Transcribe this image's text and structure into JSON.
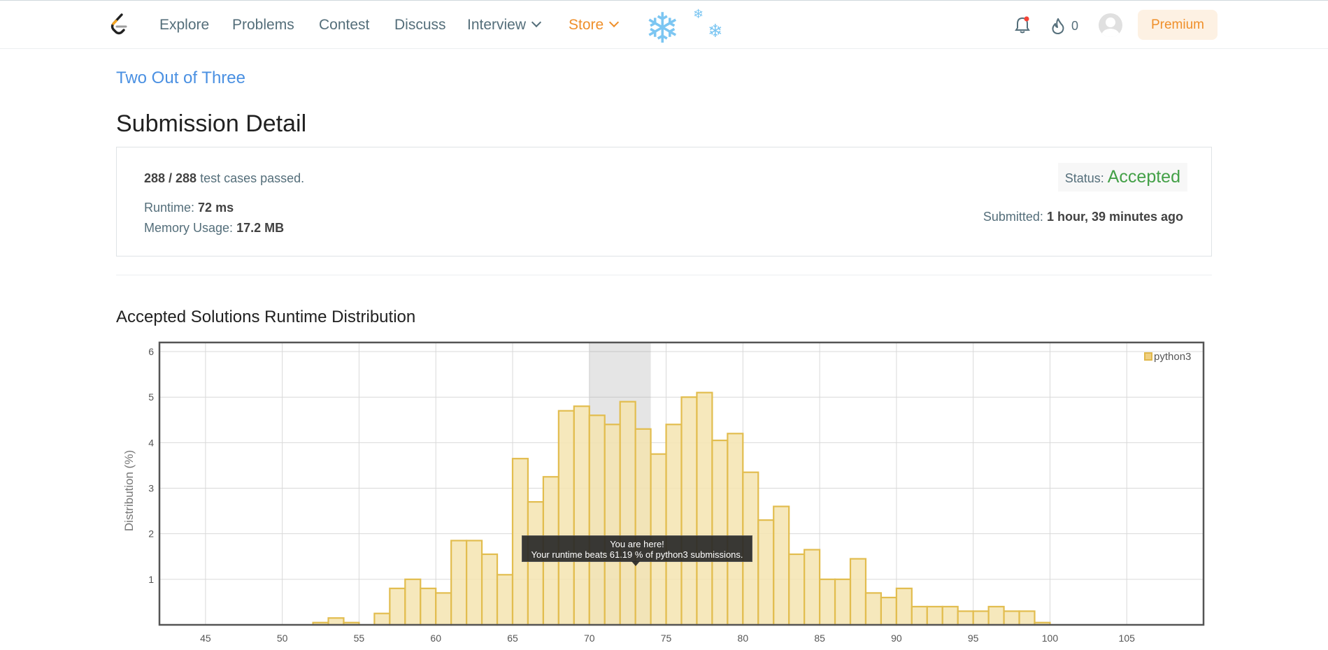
{
  "nav": {
    "items": [
      "Explore",
      "Problems",
      "Contest",
      "Discuss",
      "Interview",
      "Store"
    ],
    "fire_count": "0",
    "premium_label": "Premium"
  },
  "problem": {
    "title": "Two Out of Three"
  },
  "page_title": "Submission Detail",
  "submission": {
    "passed": "288 / 288",
    "passed_suffix": "test cases passed.",
    "runtime_label": "Runtime:",
    "runtime": "72 ms",
    "memory_label": "Memory Usage:",
    "memory": "17.2 MB",
    "status_label": "Status:",
    "status": "Accepted",
    "submitted_label": "Submitted:",
    "submitted": "1 hour, 39 minutes ago"
  },
  "colors": {
    "accent_orange": "#ef8f2a",
    "accepted_green": "#43a047",
    "link_blue": "#4a90e2",
    "bar_fill": "#f5e4b0",
    "bar_stroke": "#e2bd4f"
  },
  "chart_data": {
    "type": "bar",
    "title": "Accepted Solutions Runtime Distribution",
    "ylabel": "Distribution (%)",
    "xlabel": "",
    "xlim": [
      42,
      110
    ],
    "ylim": [
      0,
      6.2
    ],
    "x_ticks": [
      45,
      50,
      55,
      60,
      65,
      70,
      75,
      80,
      85,
      90,
      95,
      100,
      105
    ],
    "y_ticks": [
      1,
      2,
      3,
      4,
      5,
      6
    ],
    "grid": true,
    "legend": {
      "entries": [
        "python3"
      ],
      "position": "top-right"
    },
    "highlight_range": [
      70,
      74
    ],
    "tooltip": {
      "line1": "You are here!",
      "line2": "Your runtime beats 61.19 % of python3 submissions."
    },
    "bin_width": 1,
    "series": [
      {
        "name": "python3",
        "x": [
          52,
          53,
          54,
          55,
          56,
          57,
          58,
          59,
          60,
          61,
          62,
          63,
          64,
          65,
          66,
          67,
          68,
          69,
          70,
          71,
          72,
          73,
          74,
          75,
          76,
          77,
          78,
          79,
          80,
          81,
          82,
          83,
          84,
          85,
          86,
          87,
          88,
          89,
          90,
          91,
          92,
          93,
          94,
          95,
          96,
          97,
          98,
          99
        ],
        "values": [
          0.05,
          0.15,
          0.05,
          0,
          0.25,
          0.8,
          1.0,
          0.8,
          0.7,
          1.85,
          1.85,
          1.55,
          1.1,
          3.65,
          2.7,
          3.25,
          4.7,
          4.8,
          4.6,
          4.4,
          4.9,
          4.3,
          3.75,
          4.4,
          5.0,
          5.1,
          4.05,
          4.2,
          3.35,
          2.3,
          2.6,
          1.55,
          1.65,
          1.0,
          1.0,
          1.45,
          0.7,
          0.6,
          0.8,
          0.4,
          0.4,
          0.4,
          0.3,
          0.3,
          0.4,
          0.3,
          0.3,
          0.05
        ]
      }
    ]
  }
}
